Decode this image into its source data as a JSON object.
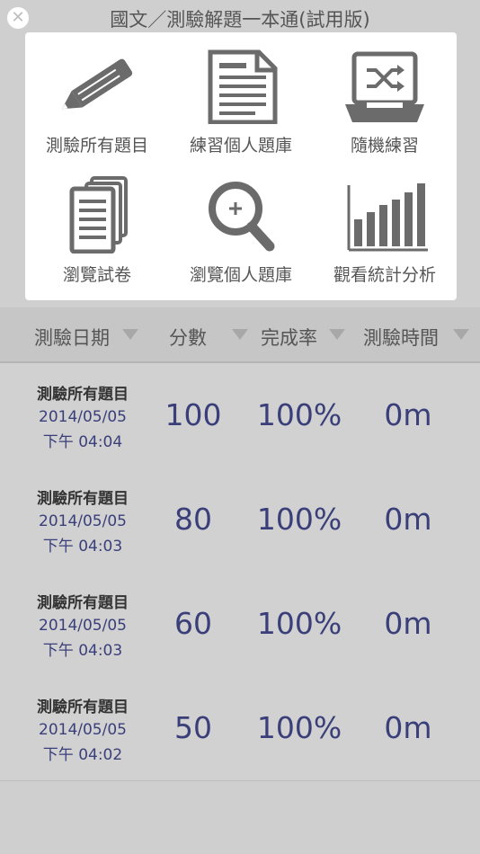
{
  "title": "國文／測驗解題一本通(試用版)",
  "close_icon": "close-icon",
  "menu": [
    {
      "label": "測驗所有題目",
      "icon": "pencil-icon"
    },
    {
      "label": "練習個人題庫",
      "icon": "document-icon"
    },
    {
      "label": "隨機練習",
      "icon": "shuffle-tray-icon"
    },
    {
      "label": "瀏覽試卷",
      "icon": "stacked-papers-icon"
    },
    {
      "label": "瀏覽個人題庫",
      "icon": "magnifier-plus-icon"
    },
    {
      "label": "觀看統計分析",
      "icon": "bar-chart-icon"
    }
  ],
  "table": {
    "headers": [
      "測驗日期",
      "分數",
      "完成率",
      "測驗時間"
    ],
    "rows": [
      {
        "title": "測驗所有題目",
        "date": "2014/05/05",
        "time": "下午 04:04",
        "score": "100",
        "completion": "100%",
        "duration": "0m"
      },
      {
        "title": "測驗所有題目",
        "date": "2014/05/05",
        "time": "下午 04:03",
        "score": "80",
        "completion": "100%",
        "duration": "0m"
      },
      {
        "title": "測驗所有題目",
        "date": "2014/05/05",
        "time": "下午 04:03",
        "score": "60",
        "completion": "100%",
        "duration": "0m"
      },
      {
        "title": "測驗所有題目",
        "date": "2014/05/05",
        "time": "下午 04:02",
        "score": "50",
        "completion": "100%",
        "duration": "0m"
      }
    ]
  },
  "colors": {
    "icon": "#6b6b6b",
    "value_text": "#3a3f7a",
    "background": "#cfcfcf"
  }
}
